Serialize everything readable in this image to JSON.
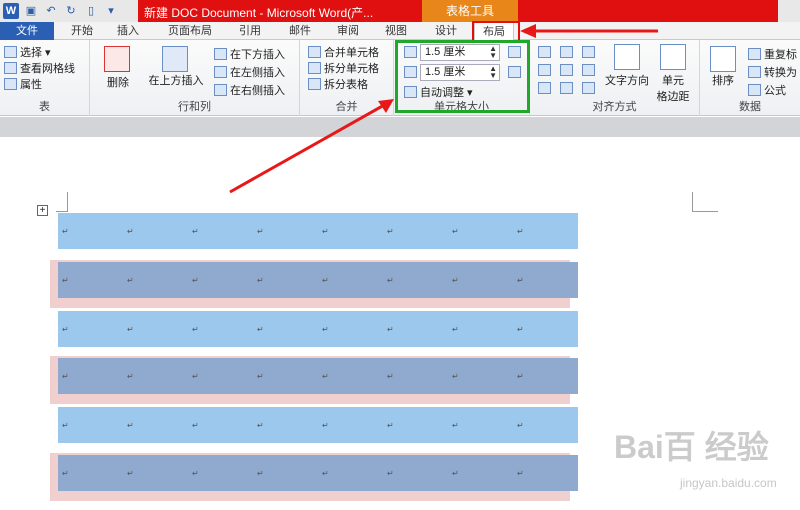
{
  "titlebar": {
    "title": "新建 DOC Document - Microsoft Word(产...",
    "context_tools": "表格工具",
    "logo": "W"
  },
  "tabs": [
    "文件",
    "开始",
    "插入",
    "页面布局",
    "引用",
    "邮件",
    "审阅",
    "视图",
    "设计",
    "布局"
  ],
  "ribbon": {
    "table_group": {
      "select": "选择 ▾",
      "gridlines": "查看网格线",
      "properties": "属性",
      "label": "表"
    },
    "rows_cols": {
      "delete": "删除",
      "insert_above": "在上方插入",
      "insert_below": "在下方插入",
      "insert_left": "在左侧插入",
      "insert_right": "在右侧插入",
      "label": "行和列"
    },
    "merge": {
      "merge_cells": "合并单元格",
      "split_cells": "拆分单元格",
      "split_table": "拆分表格",
      "label": "合并"
    },
    "cell_size": {
      "height": "1.5 厘米",
      "width": "1.5 厘米",
      "autofit": "自动调整 ▾",
      "label": "单元格大小"
    },
    "alignment": {
      "text_direction": "文字方向",
      "cell_margins_line1": "单元",
      "cell_margins_line2": "格边距",
      "label": "对齐方式"
    },
    "data": {
      "sort": "排序",
      "repeat_header": "重复标",
      "convert": "转换为",
      "formula": "公式",
      "label": "数据"
    }
  },
  "document": {
    "cell_mark": "↵",
    "table_handle": "+"
  },
  "watermark": {
    "brand": "Bai百 经验",
    "url": "jingyan.baidu.com"
  },
  "colors": {
    "accent_red": "#e01010",
    "tools_orange": "#e8861a",
    "highlight_green": "#1fa82a",
    "row_blue": "#9cc8ee",
    "row_dark": "#8fa9cf",
    "row_pink": "#f0cfcf"
  }
}
